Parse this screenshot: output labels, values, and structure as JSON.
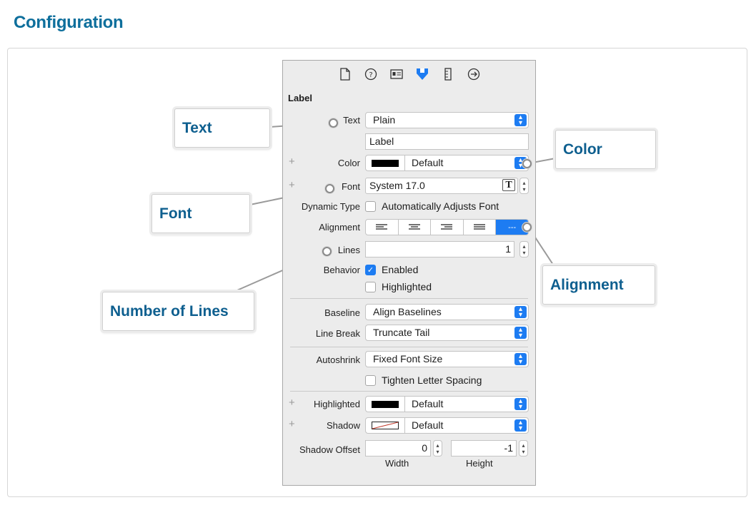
{
  "section_title": "Configuration",
  "inspector": {
    "tabs": [
      {
        "icon": "file-icon"
      },
      {
        "icon": "help-icon"
      },
      {
        "icon": "identity-icon"
      },
      {
        "icon": "attributes-icon",
        "active": true
      },
      {
        "icon": "size-ruler-icon"
      },
      {
        "icon": "connections-icon"
      }
    ],
    "heading": "Label",
    "text": {
      "label": "Text",
      "value": "Plain",
      "content": "Label"
    },
    "color": {
      "label": "Color",
      "value": "Default"
    },
    "font": {
      "label": "Font",
      "value": "System 17.0",
      "button_glyph": "T"
    },
    "dynamic_type": {
      "label": "Dynamic Type",
      "checkbox_label": "Automatically Adjusts Font",
      "checked": false
    },
    "alignment": {
      "label": "Alignment",
      "options": [
        "left",
        "center",
        "right",
        "justified",
        "natural"
      ],
      "selected": "natural",
      "natural_glyph": "---"
    },
    "lines": {
      "label": "Lines",
      "value": "1"
    },
    "behavior": {
      "label": "Behavior",
      "enabled_label": "Enabled",
      "enabled": true,
      "highlighted_label": "Highlighted",
      "highlighted": false
    },
    "baseline": {
      "label": "Baseline",
      "value": "Align Baselines"
    },
    "line_break": {
      "label": "Line Break",
      "value": "Truncate Tail"
    },
    "autoshrink": {
      "label": "Autoshrink",
      "value": "Fixed Font Size",
      "tighten_label": "Tighten Letter Spacing",
      "tighten": false
    },
    "highlighted": {
      "label": "Highlighted",
      "value": "Default"
    },
    "shadow": {
      "label": "Shadow",
      "value": "Default"
    },
    "shadow_offset": {
      "label": "Shadow Offset",
      "width": "0",
      "height": "-1",
      "width_label": "Width",
      "height_label": "Height"
    },
    "plus_glyph": "+",
    "checkmark": "✓"
  },
  "callouts": {
    "text": "Text",
    "font": "Font",
    "number_of_lines": "Number of Lines",
    "color": "Color",
    "alignment": "Alignment"
  },
  "colors": {
    "accent": "#1d7cf2",
    "callout_text": "#0e5f8f",
    "title": "#0e6f9c"
  }
}
